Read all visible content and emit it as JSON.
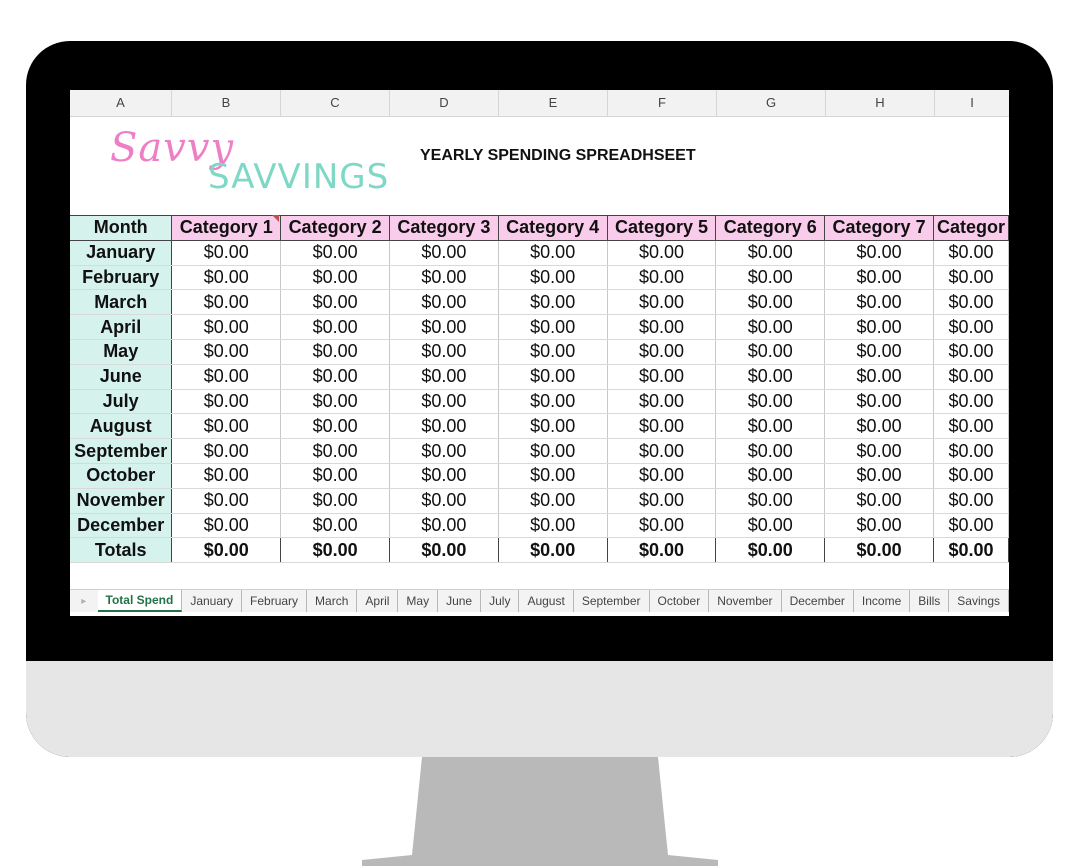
{
  "column_headers": [
    "A",
    "B",
    "C",
    "D",
    "E",
    "F",
    "G",
    "H",
    "I"
  ],
  "logo": {
    "script_text": "Savvy",
    "block_text": "SAVVINGS"
  },
  "sheet_title": "YEARLY SPENDING SPREADHSEET",
  "table": {
    "month_header": "Month",
    "categories": [
      "Category 1",
      "Category 2",
      "Category 3",
      "Category 4",
      "Category 5",
      "Category 6",
      "Category 7",
      "Categor"
    ],
    "rows": [
      {
        "month": "January",
        "values": [
          "$0.00",
          "$0.00",
          "$0.00",
          "$0.00",
          "$0.00",
          "$0.00",
          "$0.00",
          "$0.00"
        ]
      },
      {
        "month": "February",
        "values": [
          "$0.00",
          "$0.00",
          "$0.00",
          "$0.00",
          "$0.00",
          "$0.00",
          "$0.00",
          "$0.00"
        ]
      },
      {
        "month": "March",
        "values": [
          "$0.00",
          "$0.00",
          "$0.00",
          "$0.00",
          "$0.00",
          "$0.00",
          "$0.00",
          "$0.00"
        ]
      },
      {
        "month": "April",
        "values": [
          "$0.00",
          "$0.00",
          "$0.00",
          "$0.00",
          "$0.00",
          "$0.00",
          "$0.00",
          "$0.00"
        ]
      },
      {
        "month": "May",
        "values": [
          "$0.00",
          "$0.00",
          "$0.00",
          "$0.00",
          "$0.00",
          "$0.00",
          "$0.00",
          "$0.00"
        ]
      },
      {
        "month": "June",
        "values": [
          "$0.00",
          "$0.00",
          "$0.00",
          "$0.00",
          "$0.00",
          "$0.00",
          "$0.00",
          "$0.00"
        ]
      },
      {
        "month": "July",
        "values": [
          "$0.00",
          "$0.00",
          "$0.00",
          "$0.00",
          "$0.00",
          "$0.00",
          "$0.00",
          "$0.00"
        ]
      },
      {
        "month": "August",
        "values": [
          "$0.00",
          "$0.00",
          "$0.00",
          "$0.00",
          "$0.00",
          "$0.00",
          "$0.00",
          "$0.00"
        ]
      },
      {
        "month": "September",
        "values": [
          "$0.00",
          "$0.00",
          "$0.00",
          "$0.00",
          "$0.00",
          "$0.00",
          "$0.00",
          "$0.00"
        ]
      },
      {
        "month": "October",
        "values": [
          "$0.00",
          "$0.00",
          "$0.00",
          "$0.00",
          "$0.00",
          "$0.00",
          "$0.00",
          "$0.00"
        ]
      },
      {
        "month": "November",
        "values": [
          "$0.00",
          "$0.00",
          "$0.00",
          "$0.00",
          "$0.00",
          "$0.00",
          "$0.00",
          "$0.00"
        ]
      },
      {
        "month": "December",
        "values": [
          "$0.00",
          "$0.00",
          "$0.00",
          "$0.00",
          "$0.00",
          "$0.00",
          "$0.00",
          "$0.00"
        ]
      }
    ],
    "totals_label": "Totals",
    "totals": [
      "$0.00",
      "$0.00",
      "$0.00",
      "$0.00",
      "$0.00",
      "$0.00",
      "$0.00",
      "$0.00"
    ]
  },
  "sheet_tabs": [
    "Total Spend",
    "January",
    "February",
    "March",
    "April",
    "May",
    "June",
    "July",
    "August",
    "September",
    "October",
    "November",
    "December",
    "Income",
    "Bills",
    "Savings"
  ],
  "active_tab": "Total Spend",
  "colors": {
    "month_fill": "#d5f2ec",
    "category_fill": "#f9ccec",
    "logo_pink": "#ee7ec6",
    "logo_teal": "#7fd8c6",
    "active_tab_green": "#217346",
    "monitor_bezel": "#000000",
    "monitor_chin": "#e6e6e6",
    "stand": "#b9b9b9"
  }
}
